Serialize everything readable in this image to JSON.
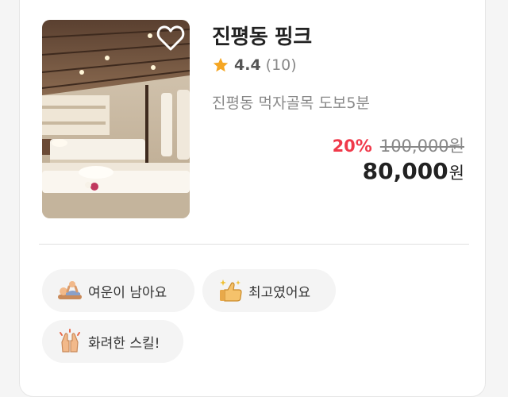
{
  "listing": {
    "title": "진평동 핑크",
    "rating": "4.4",
    "review_count": "(10)",
    "location": "진평동 먹자골목 도보5분",
    "discount": "20%",
    "original_price": "100,000원",
    "final_price": "80,000",
    "currency": "원",
    "image_icon": "spa-room-photo",
    "favorite_icon": "heart-outline-icon",
    "star_icon": "star-icon"
  },
  "tags": [
    {
      "label": "여운이 남아요",
      "icon": "massage-icon"
    },
    {
      "label": "최고였어요",
      "icon": "thumbs-up-sparkle-icon"
    },
    {
      "label": "화려한 스킬!",
      "icon": "praying-hands-icon"
    }
  ],
  "colors": {
    "discount": "#f0394a",
    "star": "#f5a623",
    "text_primary": "#222222",
    "text_secondary": "#888888",
    "tag_background": "#f4f4f4"
  }
}
